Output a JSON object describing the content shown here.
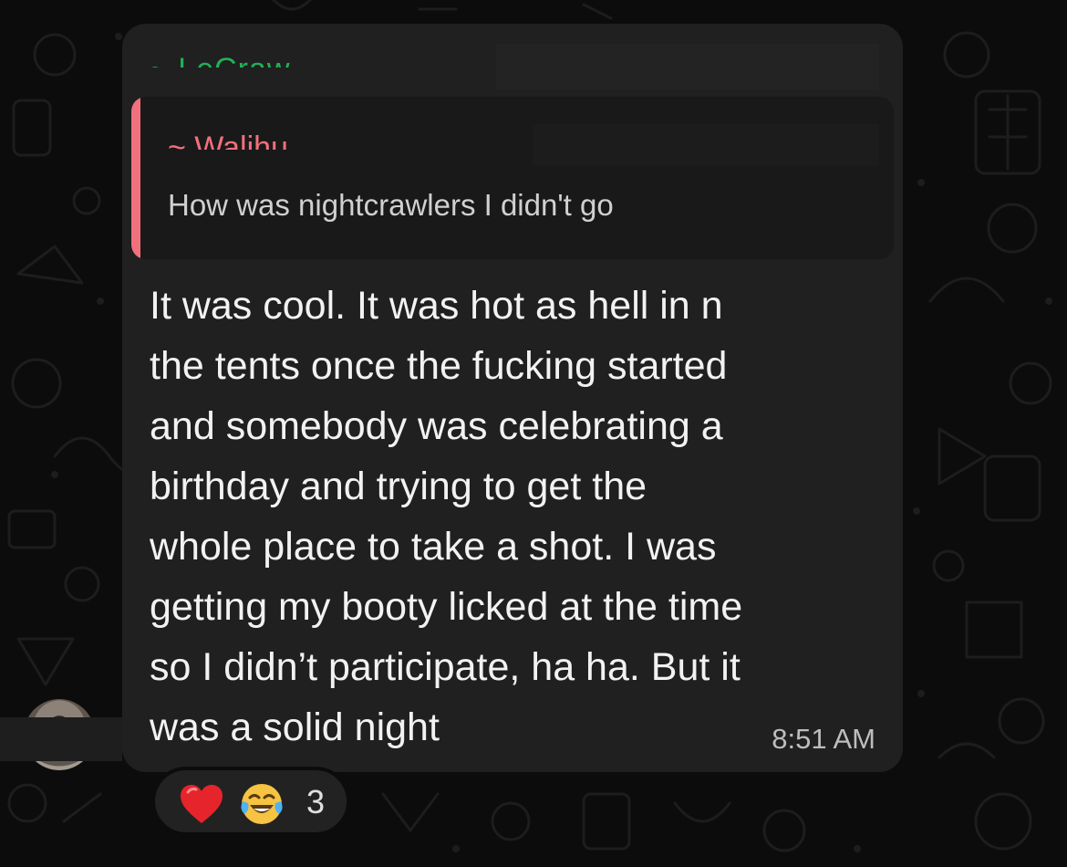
{
  "chat": {
    "sender_name": "~ LeCraw",
    "quoted": {
      "author": "~ Walihu",
      "text": "How was nightcrawlers I  didn't go"
    },
    "message": "It was cool. It was hot as hell in n\nthe tents once the fucking started\nand somebody was celebrating a\nbirthday and trying to get the\nwhole place to take a shot. I was\ngetting my booty licked at the time\nso I didn’t participate, ha ha. But it\nwas a solid night",
    "timestamp": "8:51 AM"
  },
  "reactions": {
    "icons": [
      "heart-icon",
      "laugh-icon"
    ],
    "count": "3"
  },
  "colors": {
    "background": "#0c0c0c",
    "bubble": "#202020",
    "quote_bg": "#191919",
    "quote_bar": "#f0717d",
    "sender_green": "#1fb256",
    "quote_author_pink": "#f2707c",
    "text": "#f2f2f2"
  }
}
